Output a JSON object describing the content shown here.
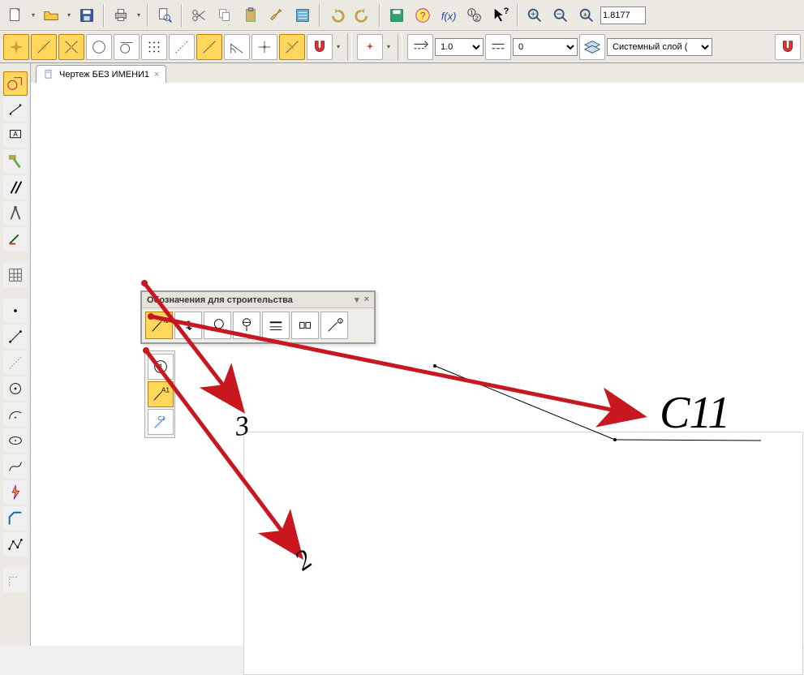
{
  "top_toolbar": {
    "icons": [
      "new-file-icon",
      "open-file-icon",
      "save-icon",
      "sep",
      "print-icon",
      "sep",
      "print-preview-icon",
      "sep",
      "cut-icon",
      "copy-icon",
      "paste-icon",
      "brush-icon",
      "properties-icon",
      "sep",
      "undo-icon",
      "redo-icon",
      "sep",
      "disk-blue-icon",
      "help-wizard-icon",
      "fx-icon",
      "numbers12-icon",
      "whatsthis-icon"
    ],
    "zoom_value": "1.8177"
  },
  "toolbar2": {
    "combo1_value": "1.0",
    "combo2_value": "0",
    "layer_label": "Системный слой ("
  },
  "tab": {
    "label": "Чертеж БЕЗ ИМЕНИ1",
    "close": "×"
  },
  "panel": {
    "title": "Обозначения для строительства",
    "min": "▾",
    "close": "×"
  },
  "flyout": {
    "items": [
      "1",
      "A1",
      "C1"
    ]
  },
  "annotations": {
    "n3": "3",
    "n2": "2",
    "c11": "С11"
  }
}
